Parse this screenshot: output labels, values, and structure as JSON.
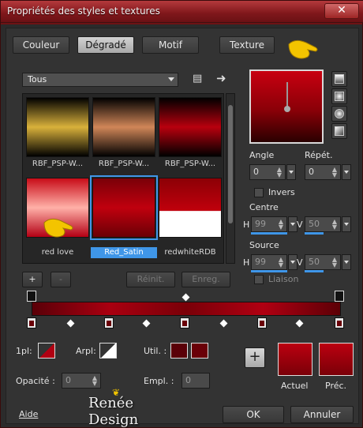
{
  "window": {
    "title": "Propriétés des styles et textures",
    "close_symbol": "✕"
  },
  "tabs": [
    {
      "label": "Couleur",
      "active": false
    },
    {
      "label": "Dégradé",
      "active": true
    },
    {
      "label": "Motif",
      "active": false
    },
    {
      "label": "Texture",
      "active": false
    }
  ],
  "category_dropdown": {
    "value": "Tous"
  },
  "gradients": [
    {
      "label": "RBF_PSP-W...",
      "colors": [
        "#000000",
        "#d9b13b",
        "#000000"
      ],
      "selected": false
    },
    {
      "label": "RBF_PSP-W...",
      "colors": [
        "#000000",
        "#d08658",
        "#000000"
      ],
      "selected": false
    },
    {
      "label": "RBF_PSP-W...",
      "colors": [
        "#000000",
        "#b8000e",
        "#000000"
      ],
      "selected": false
    },
    {
      "label": "red love",
      "colors": [
        "#c80c18",
        "#ffb0a8",
        "#b30014"
      ],
      "selected": false
    },
    {
      "label": "Red_Satin",
      "colors": [
        "#7a0008",
        "#c0000e",
        "#6a0006"
      ],
      "selected": true
    },
    {
      "label": "redwhiteRDB",
      "colors": [
        "#8c0006",
        "#c0000c",
        "#ffffff"
      ],
      "selected": false
    }
  ],
  "list_buttons": {
    "add": "+",
    "remove": "-",
    "reset": "Réinit.",
    "save": "Enreg."
  },
  "params": {
    "angle_label": "Angle",
    "angle": "0",
    "repeat_label": "Répét.",
    "repeat": "0",
    "invert_label": "Invers",
    "center_label": "Centre",
    "center_h": "99",
    "center_v": "50",
    "source_label": "Source",
    "source_h": "99",
    "source_v": "50",
    "link_label": "Liaison",
    "h": "H",
    "v": "V"
  },
  "bottom": {
    "one_plane_label": "1pl:",
    "back_plane_label": "Arpl:",
    "used_label": "Util. :",
    "opacity_label": "Opacité :",
    "opacity": "0",
    "location_label": "Empl. :",
    "location": "0",
    "current_label": "Actuel",
    "previous_label": "Préc.",
    "plus": "+"
  },
  "footer": {
    "help": "Aide",
    "ok": "OK",
    "cancel": "Annuler",
    "watermark": "Renée Design"
  },
  "colors": {
    "accent": "#3f96e8",
    "red": "#b00012"
  }
}
